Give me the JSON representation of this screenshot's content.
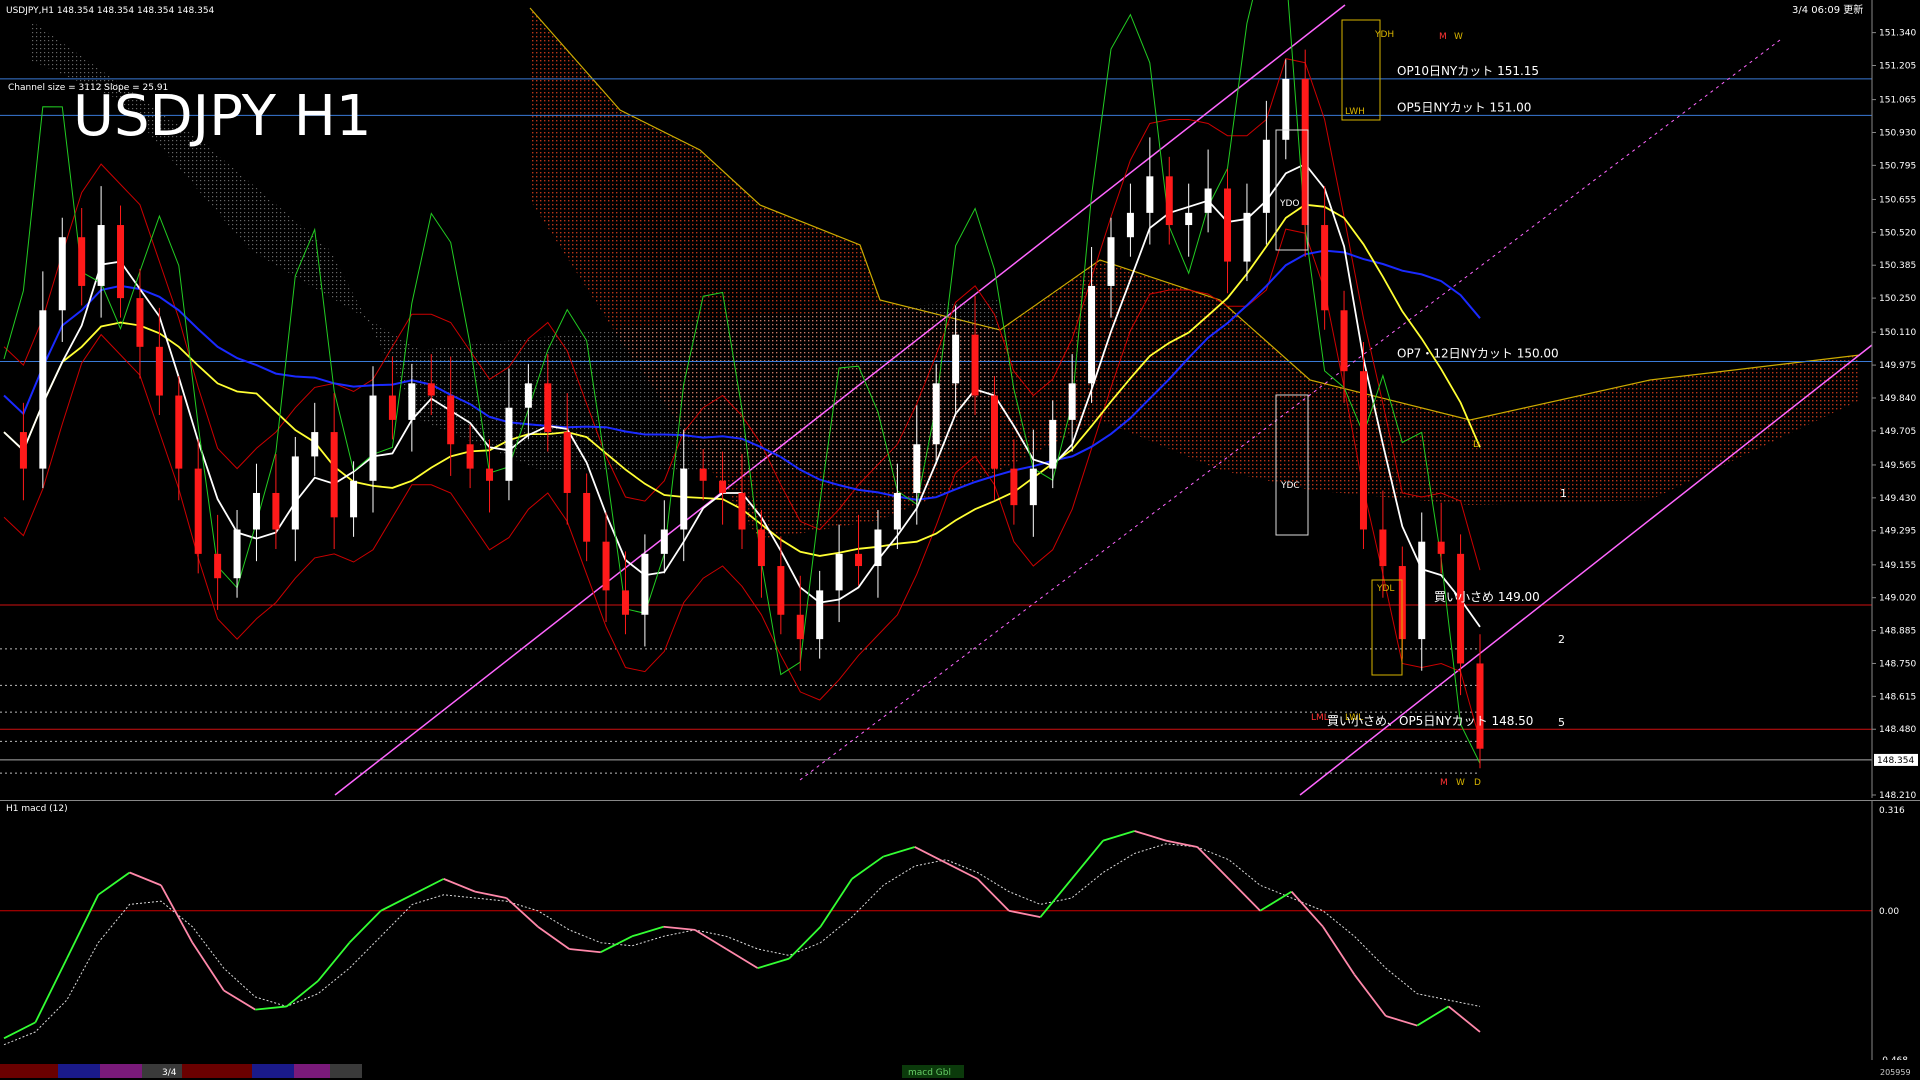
{
  "header": {
    "symbol_info": "USDJPY,H1 148.354 148.354 148.354 148.354",
    "channel_info": "Channel size = 3112 Slope = 25.91",
    "big_title": "USDJPY H1",
    "time_label": "3/4 06:09 更新"
  },
  "colors": {
    "bg": "#000000",
    "bull": "#ffffff",
    "bear": "#ff1a1a",
    "ma_white": "#ffffff",
    "ma_yellow": "#ffff33",
    "ma_blue": "#1a2aff",
    "band_red": "#cc0000",
    "channel": "#ff66ff",
    "cloud": "#cc2200",
    "macd_up": "#33ff33",
    "macd_down": "#ff88aa",
    "signal": "#dddddd"
  },
  "chart_data": [
    {
      "type": "candlestick",
      "title": "USDJPY H1",
      "ylim": [
        148.21,
        151.4
      ],
      "y_ticks": [
        "151.340",
        "151.205",
        "151.065",
        "150.930",
        "150.795",
        "150.655",
        "150.520",
        "150.385",
        "150.250",
        "150.110",
        "149.975",
        "149.840",
        "149.705",
        "149.565",
        "149.430",
        "149.295",
        "149.155",
        "149.020",
        "148.885",
        "148.750",
        "148.615",
        "148.480",
        "148.210"
      ],
      "current_price": "148.354",
      "price_path": [
        149.7,
        149.55,
        150.2,
        150.5,
        150.3,
        150.55,
        150.25,
        150.05,
        149.85,
        149.55,
        149.2,
        149.1,
        149.3,
        149.45,
        149.3,
        149.6,
        149.7,
        149.35,
        149.5,
        149.85,
        149.75,
        149.9,
        149.85,
        149.65,
        149.55,
        149.5,
        149.8,
        149.9,
        149.7,
        149.45,
        149.25,
        149.05,
        148.95,
        149.2,
        149.3,
        149.55,
        149.5,
        149.45,
        149.3,
        149.15,
        148.95,
        148.85,
        149.05,
        149.2,
        149.15,
        149.3,
        149.45,
        149.65,
        149.9,
        150.1,
        149.85,
        149.55,
        149.4,
        149.55,
        149.75,
        149.9,
        150.3,
        150.5,
        150.6,
        150.75,
        150.55,
        150.6,
        150.7,
        150.4,
        150.6,
        150.9,
        151.15,
        150.55,
        150.2,
        149.95,
        149.3,
        149.15,
        148.85,
        149.25,
        149.2,
        148.75,
        148.4
      ],
      "level_labels": [
        {
          "text": "OP10日NYカット 151.15",
          "price": 151.15
        },
        {
          "text": "OP5日NYカット 151.00",
          "price": 151.0
        },
        {
          "text": "OP7・12日NYカット 150.00",
          "price": 149.99
        },
        {
          "text": "買い小さめ 149.00",
          "price": 148.99
        },
        {
          "text": "買い小さめ、OP5日NYカット 148.50",
          "price": 148.48
        }
      ],
      "box_labels": [
        "YDH",
        "LWH",
        "YDO",
        "YDC",
        "YDL",
        "LWL",
        "LML",
        "M",
        "W",
        "D"
      ],
      "channel_labels": [
        "1",
        "2",
        "5"
      ]
    },
    {
      "type": "line",
      "title": "H1 macd (12)",
      "ylim": [
        -0.468,
        0.316
      ],
      "y_ticks": [
        "0.316",
        "0.00",
        "-0.468"
      ],
      "macd": [
        -0.4,
        -0.35,
        -0.15,
        0.05,
        0.12,
        0.08,
        -0.1,
        -0.25,
        -0.31,
        -0.3,
        -0.22,
        -0.1,
        0.0,
        0.05,
        0.1,
        0.06,
        0.04,
        -0.05,
        -0.12,
        -0.13,
        -0.08,
        -0.05,
        -0.06,
        -0.12,
        -0.18,
        -0.15,
        -0.05,
        0.1,
        0.17,
        0.2,
        0.15,
        0.1,
        0.0,
        -0.02,
        0.1,
        0.22,
        0.25,
        0.22,
        0.2,
        0.1,
        0.0,
        0.06,
        -0.05,
        -0.2,
        -0.33,
        -0.36,
        -0.3,
        -0.38
      ],
      "signal": [
        -0.42,
        -0.38,
        -0.28,
        -0.1,
        0.02,
        0.03,
        -0.05,
        -0.18,
        -0.27,
        -0.3,
        -0.26,
        -0.18,
        -0.08,
        0.02,
        0.05,
        0.04,
        0.03,
        0.0,
        -0.06,
        -0.1,
        -0.11,
        -0.08,
        -0.06,
        -0.08,
        -0.12,
        -0.14,
        -0.1,
        -0.02,
        0.08,
        0.14,
        0.16,
        0.12,
        0.06,
        0.02,
        0.04,
        0.12,
        0.18,
        0.21,
        0.2,
        0.16,
        0.08,
        0.04,
        0.0,
        -0.08,
        -0.18,
        -0.26,
        -0.28,
        -0.3
      ]
    }
  ],
  "status": {
    "tab_label": "3/4",
    "bottom_label": "macd Gbl",
    "bottom_right": "205959"
  }
}
